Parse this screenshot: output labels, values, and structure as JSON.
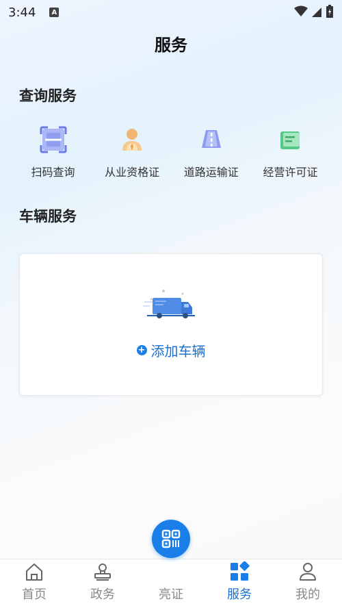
{
  "status_bar": {
    "time": "3:44",
    "notification_glyph": "A",
    "icons": [
      "wifi-icon",
      "signal-icon",
      "battery-charging-icon"
    ]
  },
  "header": {
    "title": "服务"
  },
  "query_services": {
    "title": "查询服务",
    "items": [
      {
        "label": "扫码查询",
        "icon": "scan-query-icon"
      },
      {
        "label": "从业资格证",
        "icon": "qualification-person-icon"
      },
      {
        "label": "道路运输证",
        "icon": "road-transport-icon"
      },
      {
        "label": "经营许可证",
        "icon": "business-license-icon"
      }
    ]
  },
  "vehicle_services": {
    "title": "车辆服务",
    "add_label": "添加车辆",
    "illustration": "truck-icon"
  },
  "tab_bar": {
    "items": [
      {
        "label": "首页",
        "icon": "home-icon"
      },
      {
        "label": "政务",
        "icon": "stamp-icon"
      },
      {
        "label": "亮证",
        "icon": "qr-code-icon"
      },
      {
        "label": "服务",
        "icon": "grid-icon",
        "active": true
      },
      {
        "label": "我的",
        "icon": "user-icon"
      }
    ]
  },
  "colors": {
    "accent": "#1a7ee8",
    "accent_text": "#1a6fcf",
    "inactive": "#888888"
  }
}
